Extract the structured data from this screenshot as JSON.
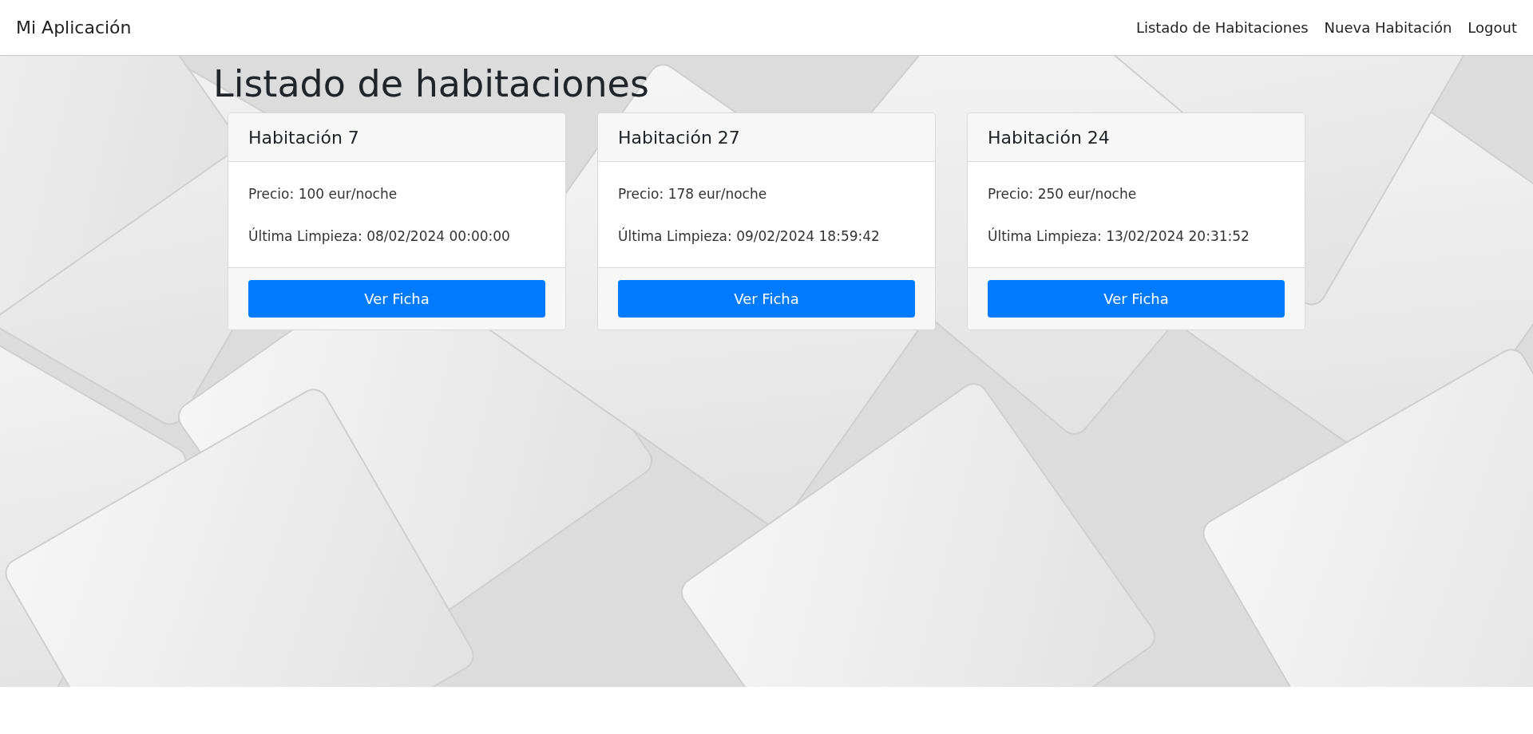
{
  "navbar": {
    "brand": "Mi Aplicación",
    "links": [
      {
        "label": "Listado de Habitaciones"
      },
      {
        "label": "Nueva Habitación"
      },
      {
        "label": "Logout"
      }
    ]
  },
  "page": {
    "title": "Listado de habitaciones"
  },
  "rooms": [
    {
      "title": "Habitación 7",
      "price": "Precio: 100 eur/noche",
      "cleaning": "Última Limpieza: 08/02/2024 00:00:00",
      "button": "Ver Ficha"
    },
    {
      "title": "Habitación 27",
      "price": "Precio: 178 eur/noche",
      "cleaning": "Última Limpieza: 09/02/2024 18:59:42",
      "button": "Ver Ficha"
    },
    {
      "title": "Habitación 24",
      "price": "Precio: 250 eur/noche",
      "cleaning": "Última Limpieza: 13/02/2024 20:31:52",
      "button": "Ver Ficha"
    }
  ]
}
